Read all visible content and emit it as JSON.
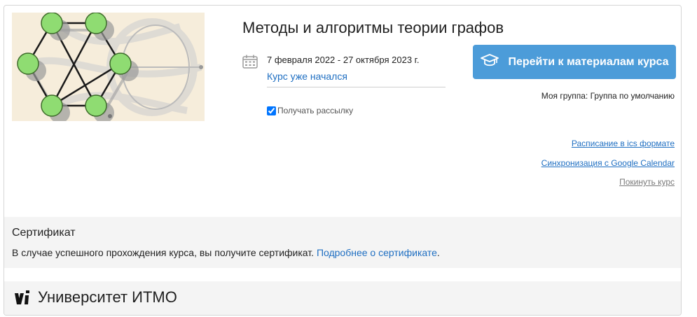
{
  "course": {
    "title": "Методы и алгоритмы теории графов",
    "dates": "7 февраля 2022 - 27 октября 2023 г.",
    "status": "Курс уже начался",
    "newsletter_label": "Получать рассылку",
    "newsletter_checked": true,
    "go_button_label": "Перейти к материалам курса",
    "group_text": "Моя группа: Группа по умолчанию",
    "links": {
      "ics": "Расписание в ics формате",
      "google": "Синхронизация с Google Calendar",
      "leave": "Покинуть курс"
    }
  },
  "certificate": {
    "title": "Сертификат",
    "text": "В случае успешного прохождения курса, вы получите сертификат.",
    "link": "Подробнее о сертификате",
    "end": "."
  },
  "university": {
    "name": "Университет ИТМО"
  },
  "colors": {
    "accent": "#4c9cd9",
    "link": "#1f6fc2",
    "node": "#8fdc72"
  },
  "icons": [
    "calendar-icon",
    "graduation-cap-icon",
    "itmo-logo"
  ]
}
